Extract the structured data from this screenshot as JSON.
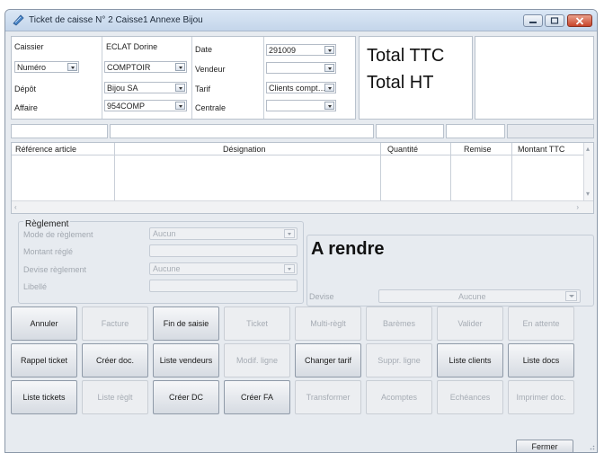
{
  "window": {
    "title": "Ticket de caisse N° 2 Caisse1 Annexe Bijou",
    "icon": "ticket-app-icon",
    "controls": [
      "minimize-icon",
      "maximize-icon",
      "close-icon"
    ]
  },
  "header": {
    "caissier_label": "Caissier",
    "caissier_value": "ECLAT Dorine",
    "numero_label": "Numéro",
    "numero_value": "COMPTOIR",
    "depot_label": "Dépôt",
    "depot_value": "Bijou SA",
    "affaire_label": "Affaire",
    "affaire_value": "954COMP",
    "date_label": "Date",
    "date_value": "291009",
    "vendeur_label": "Vendeur",
    "vendeur_value": "",
    "tarif_label": "Tarif",
    "tarif_value": "Clients compt…",
    "centrale_label": "Centrale",
    "centrale_value": ""
  },
  "totals": {
    "ttc_label": "Total TTC",
    "ht_label": "Total HT"
  },
  "table": {
    "columns": [
      "Référence article",
      "Désignation",
      "Quantité",
      "Remise",
      "Montant TTC"
    ],
    "rows": []
  },
  "reglement": {
    "title": "Règlement",
    "mode_label": "Mode de règlement",
    "mode_value": "Aucun",
    "montant_label": "Montant réglé",
    "montant_value": "",
    "devise_label": "Devise règlement",
    "devise_value": "Aucune",
    "libelle_label": "Libellé",
    "libelle_value": ""
  },
  "arendre": {
    "label": "A rendre",
    "devise_label": "Devise",
    "devise_value": "Aucune"
  },
  "buttons": {
    "row1": [
      {
        "label": "Annuler",
        "enabled": true
      },
      {
        "label": "Facture",
        "enabled": false
      },
      {
        "label": "Fin de saisie",
        "enabled": true
      },
      {
        "label": "Ticket",
        "enabled": false
      },
      {
        "label": "Multi-règlt",
        "enabled": false
      },
      {
        "label": "Barèmes",
        "enabled": false
      },
      {
        "label": "Valider",
        "enabled": false
      },
      {
        "label": "En attente",
        "enabled": false
      }
    ],
    "row2": [
      {
        "label": "Rappel ticket",
        "enabled": true
      },
      {
        "label": "Créer doc.",
        "enabled": true
      },
      {
        "label": "Liste vendeurs",
        "enabled": true
      },
      {
        "label": "Modif. ligne",
        "enabled": false
      },
      {
        "label": "Changer tarif",
        "enabled": true
      },
      {
        "label": "Suppr. ligne",
        "enabled": false
      },
      {
        "label": "Liste clients",
        "enabled": true
      },
      {
        "label": "Liste docs",
        "enabled": true
      }
    ],
    "row3": [
      {
        "label": "Liste tickets",
        "enabled": true
      },
      {
        "label": "Liste règlt",
        "enabled": false
      },
      {
        "label": "Créer DC",
        "enabled": true
      },
      {
        "label": "Créer FA",
        "enabled": true
      },
      {
        "label": "Transformer",
        "enabled": false
      },
      {
        "label": "Acomptes",
        "enabled": false
      },
      {
        "label": "Echéances",
        "enabled": false
      },
      {
        "label": "Imprimer doc.",
        "enabled": false
      }
    ]
  },
  "footer": {
    "fermer_label": "Fermer"
  }
}
